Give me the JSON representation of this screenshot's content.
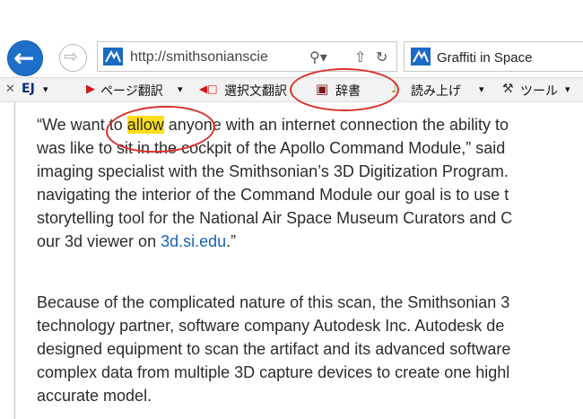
{
  "browser": {
    "address": {
      "url": "http://smithsonianscie",
      "search_glyph": "⚲▾",
      "page_glyph": "⇧",
      "refresh_glyph": "↻"
    },
    "tab": {
      "title": "Graffiti in Space"
    },
    "back_glyph": "←",
    "forward_glyph": "⇨"
  },
  "command_bar": {
    "close_glyph": "✕",
    "ej_label": "EJ",
    "ej_arrow": "▾",
    "items": [
      {
        "icon": "▶",
        "label": "ページ翻訳",
        "arrow": "▾"
      },
      {
        "icon": "◀□",
        "label": "選択文翻訳",
        "arrow": ""
      },
      {
        "icon": "▣",
        "label": "辞書",
        "arrow": ""
      },
      {
        "icon": "♪",
        "label": "読み上げ",
        "arrow": "▾"
      },
      {
        "icon": "⚒",
        "label": "ツール",
        "arrow": "▾"
      }
    ]
  },
  "article": {
    "p1": {
      "line1_before": "“We want to ",
      "highlight": "allow",
      "line1_after": " anyone with an internet connection the ability to",
      "line2": "was like to sit in the cockpit of the Apollo Command Module,” said",
      "line3": "imaging specialist with the Smithsonian’s 3D Digitization Program.",
      "line4": "navigating the interior of the Command Module our goal is to use t",
      "line5": "storytelling tool for the National Air Space Museum Curators and C",
      "line6_before": "our 3d viewer on ",
      "link": "3d.si.edu",
      "line6_after": ".”"
    },
    "p2": {
      "line1": "Because of the complicated nature of this scan, the Smithsonian 3",
      "line2": "technology partner, software company Autodesk Inc. Autodesk de",
      "line3": "designed equipment to scan the artifact and its advanced software",
      "line4": "complex data from multiple 3D capture devices to create one highl",
      "line5": "accurate model."
    }
  },
  "colors": {
    "highlight": "#ffdd1e",
    "annotation_ring": "#d9302b",
    "link": "#1a62b8",
    "back_button": "#1d6fc9"
  }
}
